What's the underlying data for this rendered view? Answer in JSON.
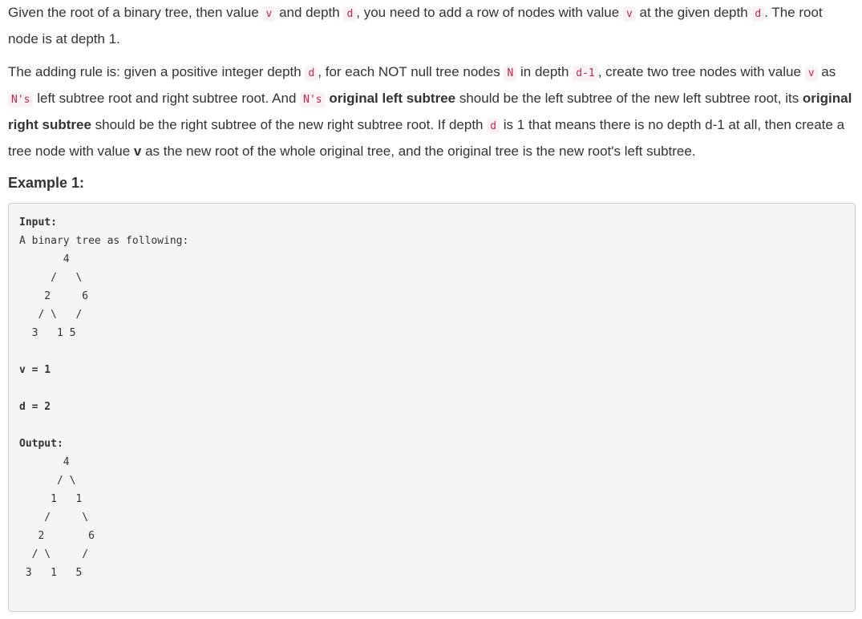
{
  "intro": {
    "s1": "Given the root of a binary tree, then value ",
    "c1": "v",
    "s2": " and depth ",
    "c2": "d",
    "s3": ", you need to add a row of nodes with value ",
    "c3": "v",
    "s4": " at the given depth ",
    "c4": "d",
    "s5": ". The root node is at depth 1."
  },
  "rule": {
    "s1": "The adding rule is: given a positive integer depth ",
    "c1": "d",
    "s2": ", for each NOT null tree nodes ",
    "c2": "N",
    "s3": " in depth ",
    "c3": "d-1",
    "s4": ", create two tree nodes with value ",
    "c4": "v",
    "s5": " as ",
    "c5": "N's",
    "s6": " left subtree root and right subtree root. And ",
    "c6": "N's",
    "b1": "original left subtree",
    "s7": " should be the left subtree of the new left subtree root, its ",
    "b2": "original right subtree",
    "s8": " should be the right subtree of the new right subtree root. If depth ",
    "c7": "d",
    "s9": " is 1 that means there is no depth d-1 at all, then create a tree node with value ",
    "b3": "v",
    "s10": " as the new root of the whole original tree, and the original tree is the new root's left subtree."
  },
  "example": {
    "heading": "Example 1:",
    "input_label": "Input:",
    "input_desc": "A binary tree as following:",
    "input_tree": "       4\n     /   \\\n    2     6\n   / \\   /\n  3   1 5",
    "v_line": "v = 1",
    "d_line": "d = 2",
    "output_label": "Output:",
    "output_tree": "       4\n      / \\\n     1   1\n    /     \\\n   2       6\n  / \\     /\n 3   1   5"
  }
}
